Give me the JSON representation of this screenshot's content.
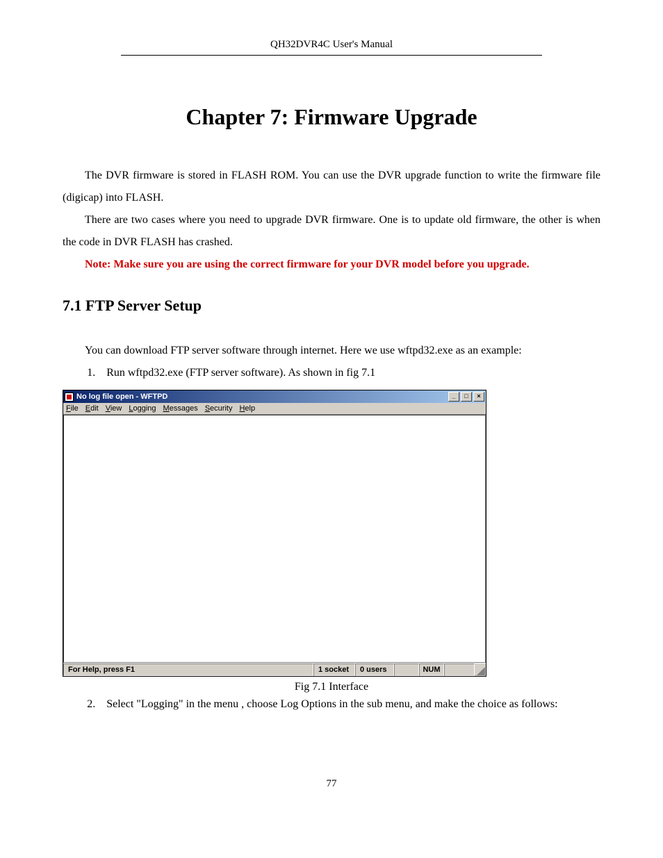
{
  "header": {
    "running_head": "QH32DVR4C User's Manual"
  },
  "chapter": {
    "title": "Chapter 7: Firmware Upgrade"
  },
  "paragraphs": {
    "p1": "The DVR firmware is stored in FLASH ROM. You can use the DVR upgrade function to write the firmware file (digicap) into FLASH.",
    "p2": "There are two cases where you need to upgrade DVR firmware. One is to update old firmware, the other is when the code in DVR FLASH has crashed.",
    "note": "Note: Make sure you are using the correct firmware for your DVR model before you upgrade."
  },
  "section": {
    "heading": "7.1  FTP Server Setup",
    "intro": "You can download FTP server software through internet. Here we use wftpd32.exe as an example:",
    "item1_num": "1.",
    "item1_text": "Run wftpd32.exe (FTP server software). As shown in fig 7.1",
    "item2_num": "2.",
    "item2_text": "Select \"Logging\" in the menu , choose Log Options in the sub menu, and make the choice as follows:"
  },
  "figure": {
    "caption": "Fig 7.1 Interface"
  },
  "app_window": {
    "title": "No log file open - WFTPD",
    "menu": {
      "file": "File",
      "edit": "Edit",
      "view": "View",
      "logging": "Logging",
      "messages": "Messages",
      "security": "Security",
      "help": "Help"
    },
    "win_controls": {
      "minimize": "_",
      "maximize": "□",
      "close": "×"
    },
    "status": {
      "help": "For Help, press F1",
      "socket": "1 socket",
      "users": "0 users",
      "num": "NUM"
    }
  },
  "page_number": "77"
}
